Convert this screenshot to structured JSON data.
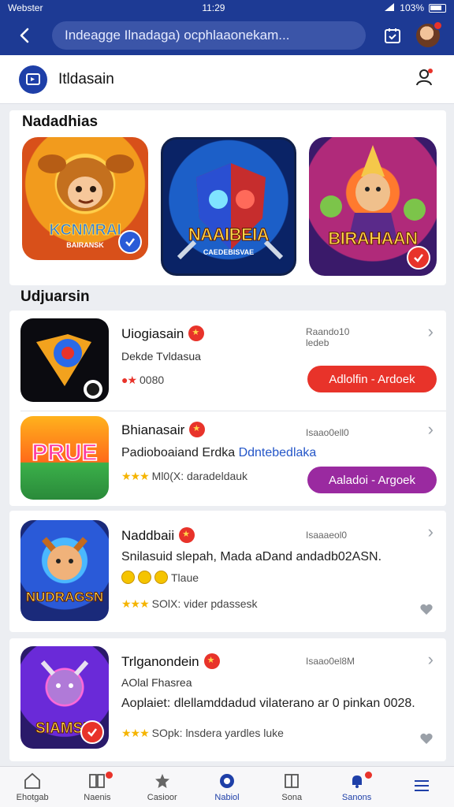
{
  "status_bar": {
    "carrier": "Webster",
    "time": "11:29",
    "battery": "103%"
  },
  "app_bar": {
    "search_text": "Indeagge Ilnadaga) ocphlaaonekam..."
  },
  "header": {
    "brand": "Itldasain"
  },
  "featured": {
    "title": "Nadadhias",
    "tiles": [
      {
        "label": "KCNMRAI",
        "sub": "BAIRANSK",
        "check": "blue"
      },
      {
        "label": "NAAIBEIA",
        "sub": "CAEDEBISVAE",
        "check": "none"
      },
      {
        "label": "BIRAHAAN",
        "sub": "",
        "check": "red"
      }
    ]
  },
  "updates": {
    "title": "Udjuarsin",
    "apps": [
      {
        "name": "Uiogiasain",
        "sub": "Dekde  Tvldasua",
        "meta1": "Raando10",
        "meta2": "ledeb",
        "rating": "0080",
        "action": "Adlolfin - Ardoek",
        "action_color": "#e8332a",
        "icon_word": ""
      },
      {
        "name": "Bhianasair",
        "desc_plain": "Padioboaiand Erdka ",
        "desc_link": "Ddntebedlaka",
        "meta1": "Isaao0ell0",
        "rating": "Ml0(X: daradeldauk",
        "action": "Aaladoi - Argoek",
        "action_color": "#9a2aa0",
        "icon_word": "PRUE"
      },
      {
        "name": "Naddbaii",
        "desc": "Snilasuid slepah, Mada aDand andadb02ASN.",
        "extra": "Tlaue",
        "meta1": "Isaaaeol0",
        "rating": "SOlX: vider pdassesk",
        "icon_word": "NUDRAGSN"
      },
      {
        "name": "Trlganondein",
        "sub": "AOlal  Fhasrea",
        "desc": "Aoplaiet: dlellamddadud vilaterano ar 0 pinkan 0028.",
        "meta1": "Isaao0el8M",
        "rating": "SOpk: lnsdera yardles luke",
        "icon_word": "SIAMSN"
      }
    ]
  },
  "bottom_nav": [
    {
      "label": "Ehotgab"
    },
    {
      "label": "Naenis"
    },
    {
      "label": "Casioor"
    },
    {
      "label": "Nabiol"
    },
    {
      "label": "Sona"
    },
    {
      "label": "Sanons"
    },
    {
      "label": ""
    }
  ]
}
